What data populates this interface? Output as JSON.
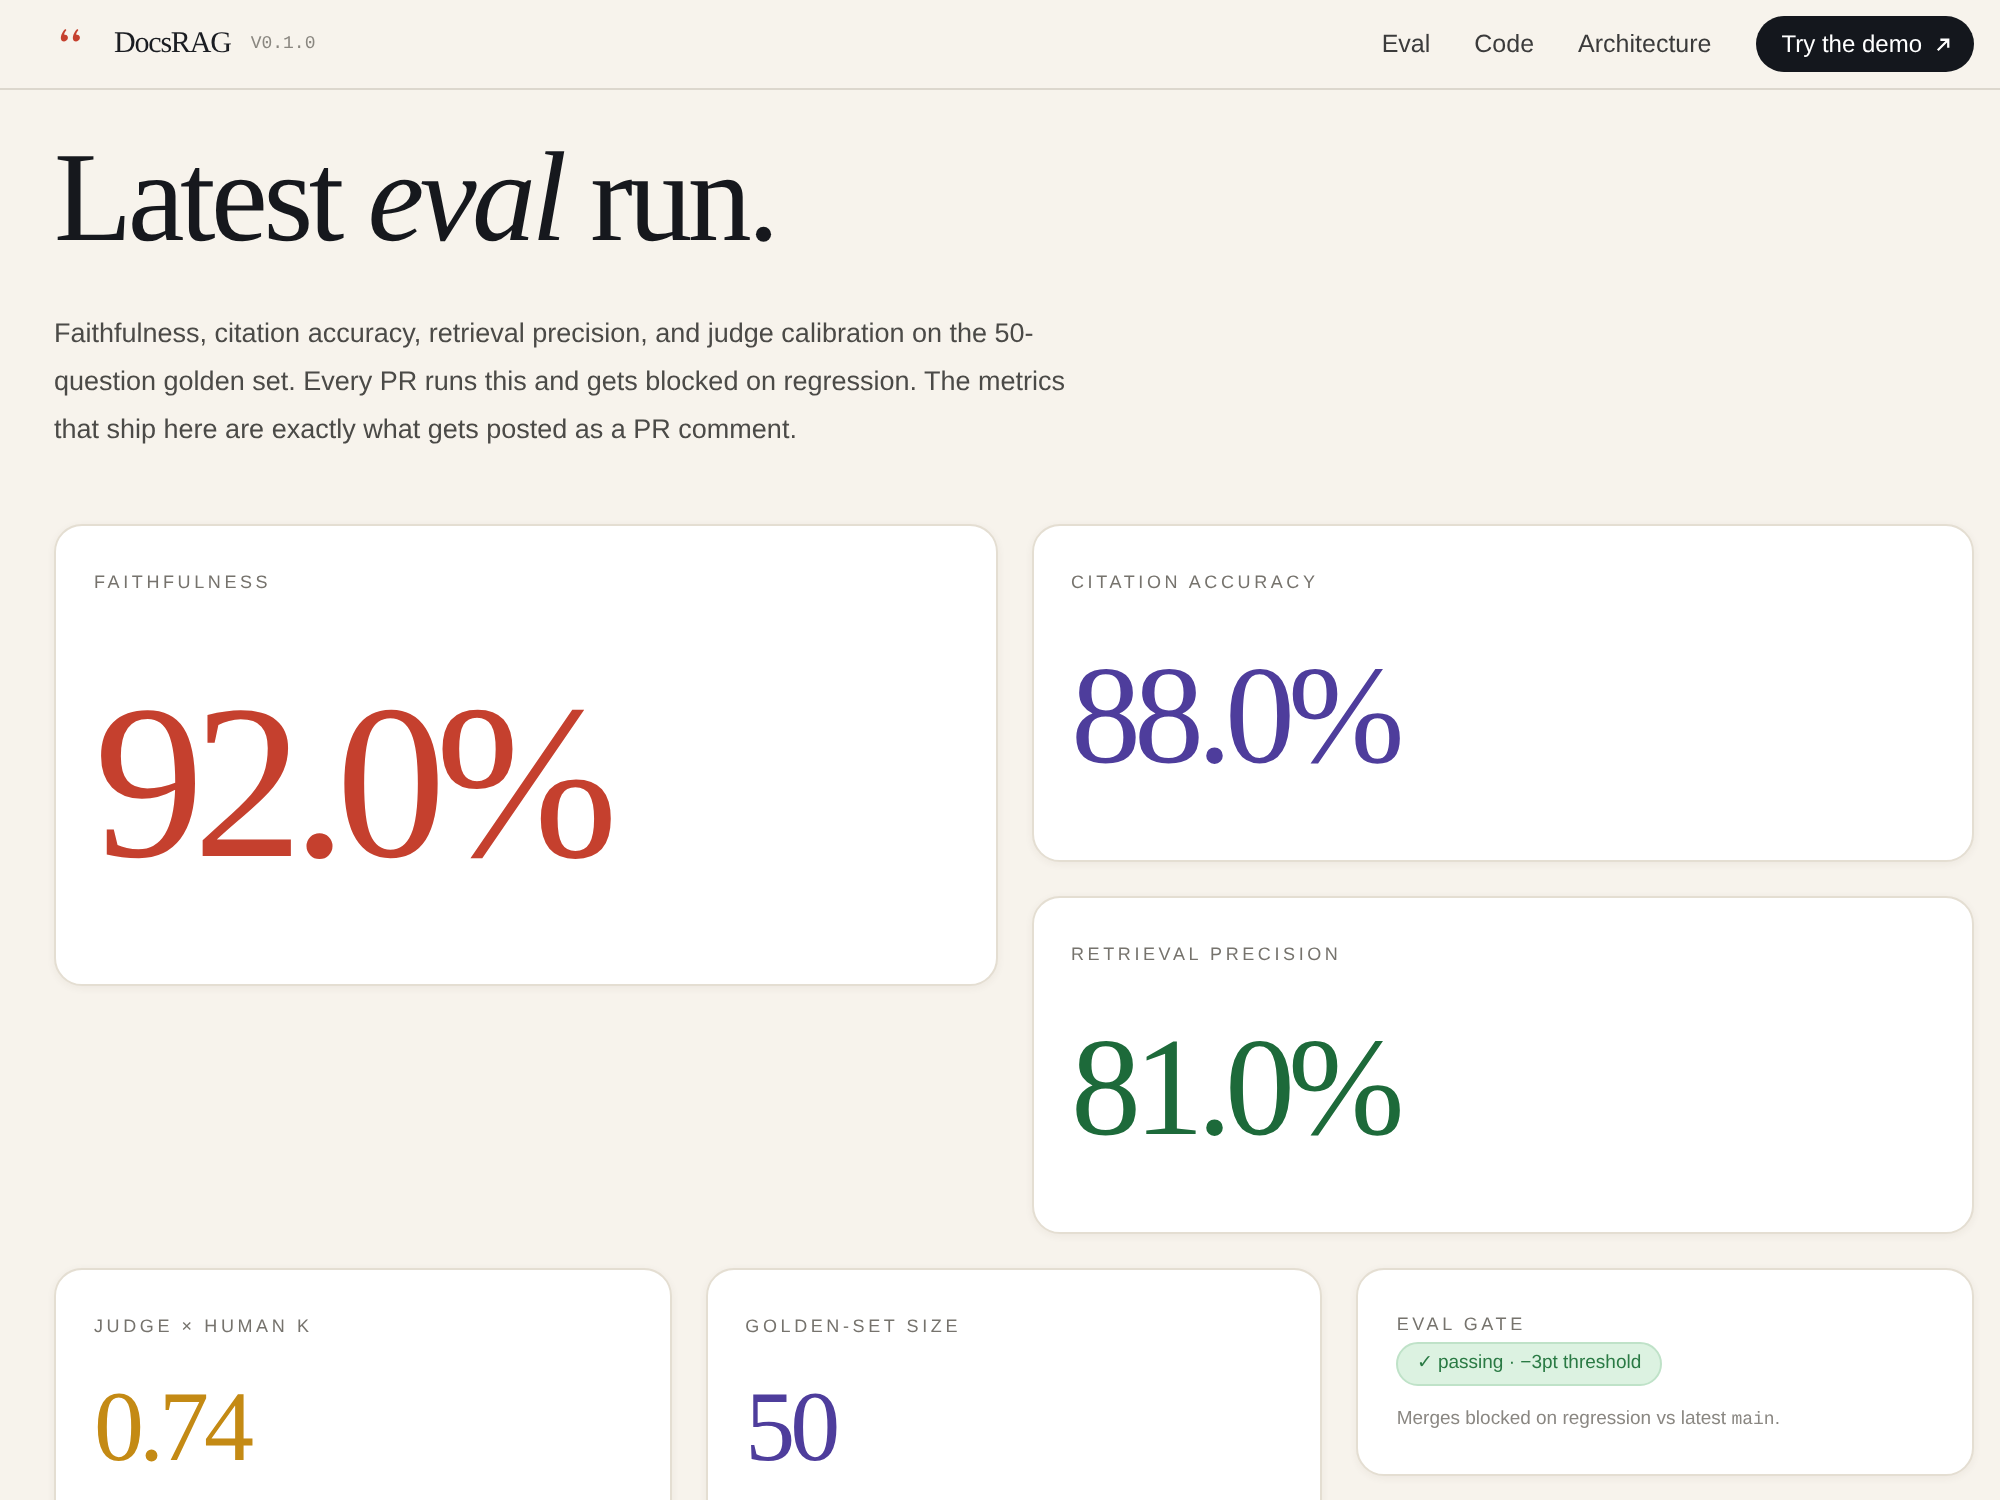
{
  "header": {
    "logo": "DocsRAG",
    "version": "V0.1.0",
    "nav": [
      "Eval",
      "Code",
      "Architecture"
    ],
    "cta": "Try the demo"
  },
  "hero": {
    "title": "Latest *eval* run.",
    "intro": "Faithfulness, citation accuracy, retrieval precision, and judge calibration on the 50-question golden set. Every PR runs this and gets blocked on regression. The metrics that ship here are exactly what gets posted as a PR comment."
  },
  "featured_metric": {
    "label": "FAITHFULNESS",
    "value": "92.0%",
    "color": "#c5402e"
  },
  "side_metrics": [
    {
      "label": "CITATION ACCURACY",
      "value": "88.0%",
      "color": "#4e3d9c"
    },
    {
      "label": "RETRIEVAL PRECISION",
      "value": "81.0%",
      "color": "#1d6a3a"
    }
  ],
  "bottom_metrics": [
    {
      "label": "JUDGE × HUMAN K",
      "value": "0.74",
      "color": "#c48a14"
    },
    {
      "label": "GOLDEN-SET SIZE",
      "value": "50",
      "color": "#4e3d9c"
    }
  ],
  "eval_gate": {
    "label": "EVAL GATE",
    "badge": {
      "text": "✓ passing · −3pt threshold",
      "kind": "pass"
    },
    "note": [
      {
        "text": "Merges blocked on regression vs latest ",
        "kind": "text"
      },
      {
        "text": "main",
        "kind": "code"
      },
      {
        "text": ".",
        "kind": "text"
      }
    ]
  }
}
